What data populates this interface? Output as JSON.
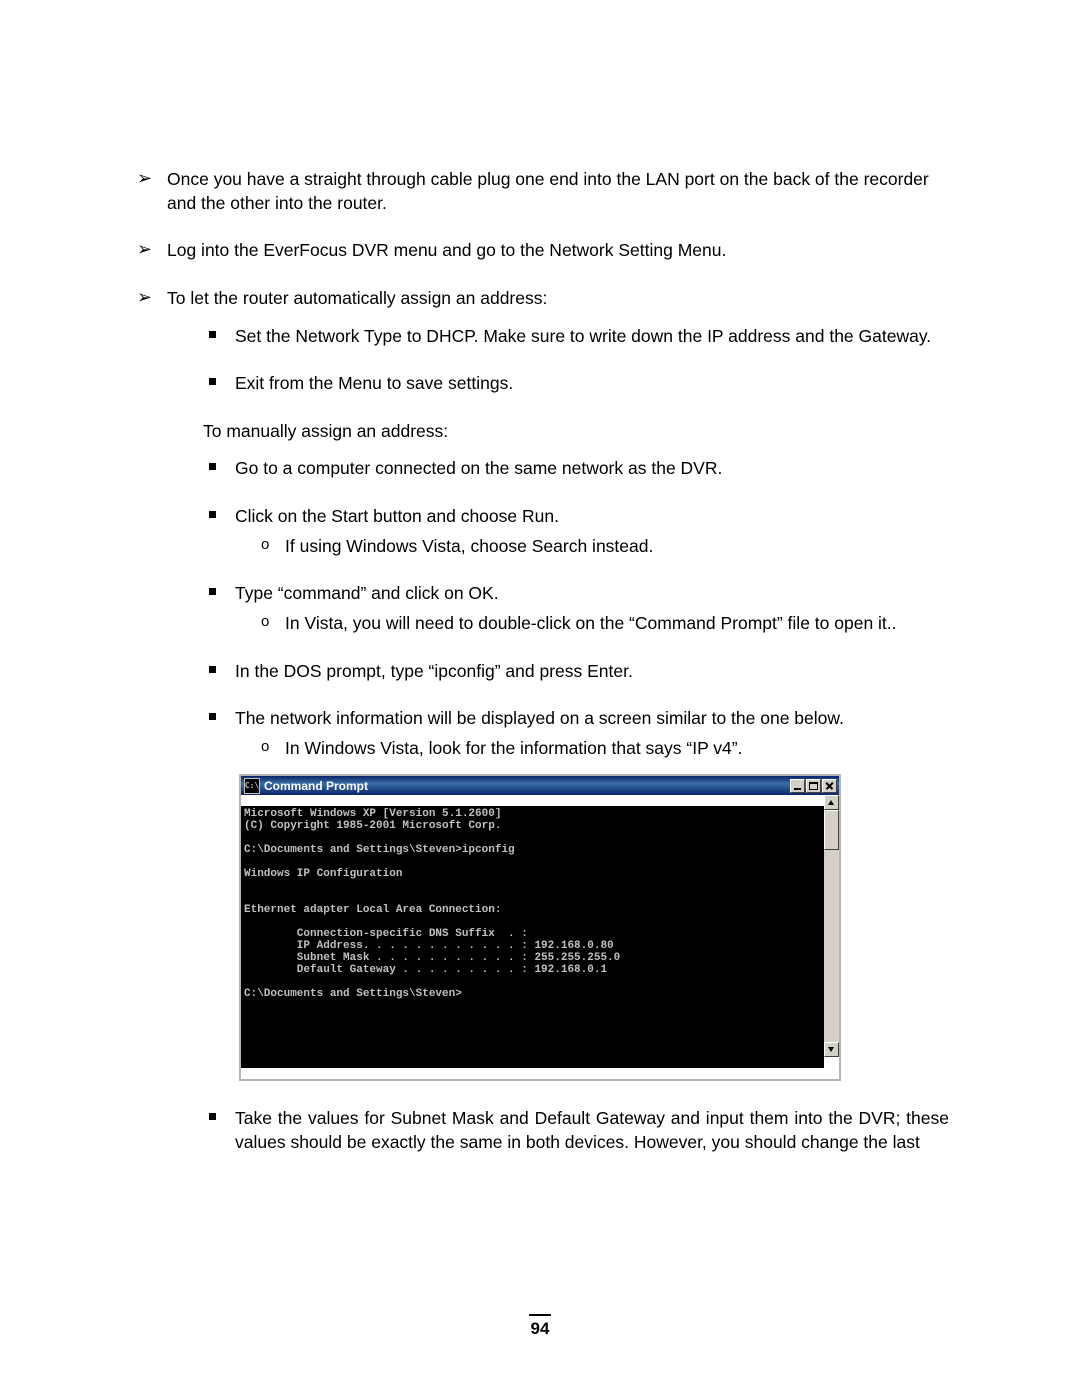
{
  "bullets": {
    "b1": "Once you have a straight through cable plug one end into the LAN port on the back of the recorder and the other into the router.",
    "b2": "Log into the EverFocus DVR menu and go to the Network Setting Menu.",
    "b3": "To let the router automatically assign an address:",
    "b3_s1": "Set the Network Type to DHCP. Make sure to write down the IP address and the Gateway.",
    "b3_s2": "Exit from the Menu to save settings.",
    "b3_note": "To manually assign an address:",
    "b3_s3": "Go to a computer connected on the same network as the DVR.",
    "b3_s4": "Click on the Start button and choose Run.",
    "b3_s4_c1": "If using Windows Vista, choose Search instead.",
    "b3_s5": "Type “command” and click on OK.",
    "b3_s5_c1": "In Vista, you will need to double-click on the “Command Prompt” file to open it..",
    "b3_s6": "In the DOS prompt, type “ipconfig” and press Enter.",
    "b3_s7": "The network information will be displayed on a screen similar to the one below.",
    "b3_s7_c1": "In Windows Vista, look for the information that says “IP v4”.",
    "b3_s8": "Take the values for Subnet Mask and Default Gateway and input them into the DVR; these values should be exactly the same in both devices. However, you should change the last"
  },
  "cmd": {
    "icon_text": "C:\\",
    "title": "Command Prompt",
    "body": "Microsoft Windows XP [Version 5.1.2600]\n(C) Copyright 1985-2001 Microsoft Corp.\n\nC:\\Documents and Settings\\Steven>ipconfig\n\nWindows IP Configuration\n\n\nEthernet adapter Local Area Connection:\n\n        Connection-specific DNS Suffix  . :\n        IP Address. . . . . . . . . . . . : 192.168.0.80\n        Subnet Mask . . . . . . . . . . . : 255.255.255.0\n        Default Gateway . . . . . . . . . : 192.168.0.1\n\nC:\\Documents and Settings\\Steven>"
  },
  "page_number": "94"
}
